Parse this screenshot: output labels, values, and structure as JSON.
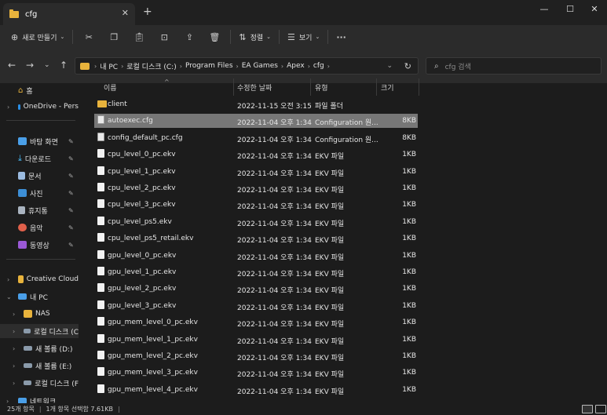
{
  "window": {
    "tab_title": "cfg",
    "tab_close": "✕",
    "new_tab": "+",
    "minimize": "—",
    "maximize": "☐",
    "close": "✕"
  },
  "command_bar": {
    "new_label": "새로 만들기",
    "sort_label": "정렬",
    "view_label": "보기",
    "more_label": "···"
  },
  "address": {
    "crumbs": [
      "내 PC",
      "로컬 디스크 (C:)",
      "Program Files",
      "EA Games",
      "Apex",
      "cfg"
    ],
    "search_placeholder": "cfg 검색"
  },
  "sidebar": {
    "home": "홈",
    "onedrive": "OneDrive - Pers",
    "quick": [
      "바탕 화면",
      "다운로드",
      "문서",
      "사진",
      "휴지통",
      "음악",
      "동영상"
    ],
    "creative_cloud": "Creative Cloud",
    "this_pc": "내 PC",
    "drives": [
      "NAS",
      "로컬 디스크 (C",
      "새 볼륨 (D:)",
      "새 볼륨 (E:)",
      "로컬 디스크 (F"
    ],
    "network": "네트워크"
  },
  "columns": {
    "name": "이름",
    "modified": "수정한 날짜",
    "type": "유형",
    "size": "크기"
  },
  "files": [
    {
      "name": "client",
      "modified": "2022-11-15 오전 3:15",
      "type": "파일 폴더",
      "size": ""
    },
    {
      "name": "autoexec.cfg",
      "modified": "2022-11-04 오후 1:34",
      "type": "Configuration 원...",
      "size": "8KB"
    },
    {
      "name": "config_default_pc.cfg",
      "modified": "2022-11-04 오후 1:34",
      "type": "Configuration 원...",
      "size": "8KB"
    },
    {
      "name": "cpu_level_0_pc.ekv",
      "modified": "2022-11-04 오후 1:34",
      "type": "EKV 파일",
      "size": "1KB"
    },
    {
      "name": "cpu_level_1_pc.ekv",
      "modified": "2022-11-04 오후 1:34",
      "type": "EKV 파일",
      "size": "1KB"
    },
    {
      "name": "cpu_level_2_pc.ekv",
      "modified": "2022-11-04 오후 1:34",
      "type": "EKV 파일",
      "size": "1KB"
    },
    {
      "name": "cpu_level_3_pc.ekv",
      "modified": "2022-11-04 오후 1:34",
      "type": "EKV 파일",
      "size": "1KB"
    },
    {
      "name": "cpu_level_ps5.ekv",
      "modified": "2022-11-04 오후 1:34",
      "type": "EKV 파일",
      "size": "1KB"
    },
    {
      "name": "cpu_level_ps5_retail.ekv",
      "modified": "2022-11-04 오후 1:34",
      "type": "EKV 파일",
      "size": "1KB"
    },
    {
      "name": "gpu_level_0_pc.ekv",
      "modified": "2022-11-04 오후 1:34",
      "type": "EKV 파일",
      "size": "1KB"
    },
    {
      "name": "gpu_level_1_pc.ekv",
      "modified": "2022-11-04 오후 1:34",
      "type": "EKV 파일",
      "size": "1KB"
    },
    {
      "name": "gpu_level_2_pc.ekv",
      "modified": "2022-11-04 오후 1:34",
      "type": "EKV 파일",
      "size": "1KB"
    },
    {
      "name": "gpu_level_3_pc.ekv",
      "modified": "2022-11-04 오후 1:34",
      "type": "EKV 파일",
      "size": "1KB"
    },
    {
      "name": "gpu_mem_level_0_pc.ekv",
      "modified": "2022-11-04 오후 1:34",
      "type": "EKV 파일",
      "size": "1KB"
    },
    {
      "name": "gpu_mem_level_1_pc.ekv",
      "modified": "2022-11-04 오후 1:34",
      "type": "EKV 파일",
      "size": "1KB"
    },
    {
      "name": "gpu_mem_level_2_pc.ekv",
      "modified": "2022-11-04 오후 1:34",
      "type": "EKV 파일",
      "size": "1KB"
    },
    {
      "name": "gpu_mem_level_3_pc.ekv",
      "modified": "2022-11-04 오후 1:34",
      "type": "EKV 파일",
      "size": "1KB"
    },
    {
      "name": "gpu_mem_level_4_pc.ekv",
      "modified": "2022-11-04 오후 1:34",
      "type": "EKV 파일",
      "size": "1KB"
    }
  ],
  "status": {
    "count": "25개 항목",
    "selection": "1개 항목 선택함 7.61KB"
  },
  "colors": {
    "folder": "#e8b33c",
    "selected_row": "#777777",
    "accent": "#4cc2ff"
  }
}
